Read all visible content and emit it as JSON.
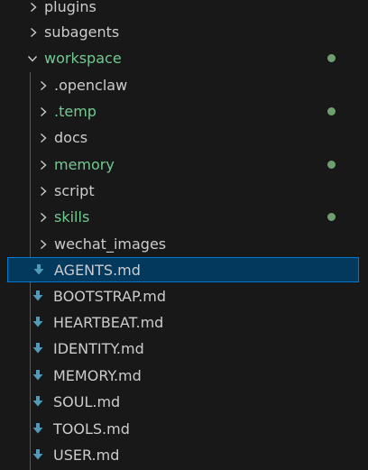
{
  "explorer": {
    "plugins": {
      "label": "plugins",
      "icon": "chevron-right-icon"
    },
    "subagents": {
      "label": "subagents",
      "icon": "chevron-right-icon"
    },
    "workspace": {
      "label": "workspace",
      "icon": "chevron-down-icon",
      "children": {
        "openclaw": {
          "label": ".openclaw",
          "icon": "chevron-right-icon"
        },
        "temp": {
          "label": ".temp",
          "icon": "chevron-right-icon"
        },
        "docs": {
          "label": "docs",
          "icon": "chevron-right-icon"
        },
        "memory": {
          "label": "memory",
          "icon": "chevron-right-icon"
        },
        "script": {
          "label": "script",
          "icon": "chevron-right-icon"
        },
        "skills": {
          "label": "skills",
          "icon": "chevron-right-icon"
        },
        "wechat_images": {
          "label": "wechat_images",
          "icon": "chevron-right-icon"
        }
      },
      "files": [
        {
          "label": "AGENTS.md",
          "icon": "markdown-down-arrow-icon",
          "selected": true
        },
        {
          "label": "BOOTSTRAP.md",
          "icon": "markdown-down-arrow-icon"
        },
        {
          "label": "HEARTBEAT.md",
          "icon": "markdown-down-arrow-icon"
        },
        {
          "label": "IDENTITY.md",
          "icon": "markdown-down-arrow-icon"
        },
        {
          "label": "MEMORY.md",
          "icon": "markdown-down-arrow-icon"
        },
        {
          "label": "SOUL.md",
          "icon": "markdown-down-arrow-icon"
        },
        {
          "label": "TOOLS.md",
          "icon": "markdown-down-arrow-icon"
        },
        {
          "label": "USER.md",
          "icon": "markdown-down-arrow-icon"
        }
      ]
    },
    "colors": {
      "background": "#181818",
      "text": "#cccccc",
      "modified_text": "#73c991",
      "modified_dot": "#6e9f6f",
      "selected_bg": "#04395e",
      "selected_border": "#0078d4",
      "markdown_icon": "#519aba"
    }
  }
}
